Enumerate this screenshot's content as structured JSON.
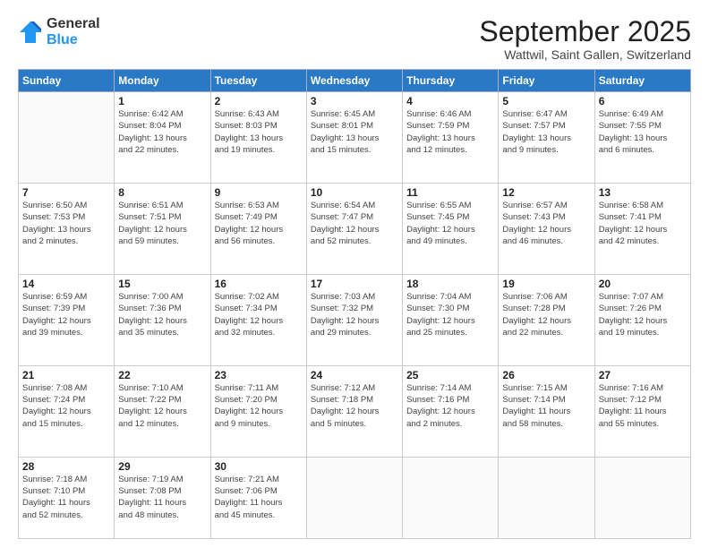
{
  "logo": {
    "general": "General",
    "blue": "Blue"
  },
  "title": {
    "month": "September 2025",
    "location": "Wattwil, Saint Gallen, Switzerland"
  },
  "weekdays": [
    "Sunday",
    "Monday",
    "Tuesday",
    "Wednesday",
    "Thursday",
    "Friday",
    "Saturday"
  ],
  "weeks": [
    [
      {
        "day": "",
        "info": ""
      },
      {
        "day": "1",
        "info": "Sunrise: 6:42 AM\nSunset: 8:04 PM\nDaylight: 13 hours\nand 22 minutes."
      },
      {
        "day": "2",
        "info": "Sunrise: 6:43 AM\nSunset: 8:03 PM\nDaylight: 13 hours\nand 19 minutes."
      },
      {
        "day": "3",
        "info": "Sunrise: 6:45 AM\nSunset: 8:01 PM\nDaylight: 13 hours\nand 15 minutes."
      },
      {
        "day": "4",
        "info": "Sunrise: 6:46 AM\nSunset: 7:59 PM\nDaylight: 13 hours\nand 12 minutes."
      },
      {
        "day": "5",
        "info": "Sunrise: 6:47 AM\nSunset: 7:57 PM\nDaylight: 13 hours\nand 9 minutes."
      },
      {
        "day": "6",
        "info": "Sunrise: 6:49 AM\nSunset: 7:55 PM\nDaylight: 13 hours\nand 6 minutes."
      }
    ],
    [
      {
        "day": "7",
        "info": "Sunrise: 6:50 AM\nSunset: 7:53 PM\nDaylight: 13 hours\nand 2 minutes."
      },
      {
        "day": "8",
        "info": "Sunrise: 6:51 AM\nSunset: 7:51 PM\nDaylight: 12 hours\nand 59 minutes."
      },
      {
        "day": "9",
        "info": "Sunrise: 6:53 AM\nSunset: 7:49 PM\nDaylight: 12 hours\nand 56 minutes."
      },
      {
        "day": "10",
        "info": "Sunrise: 6:54 AM\nSunset: 7:47 PM\nDaylight: 12 hours\nand 52 minutes."
      },
      {
        "day": "11",
        "info": "Sunrise: 6:55 AM\nSunset: 7:45 PM\nDaylight: 12 hours\nand 49 minutes."
      },
      {
        "day": "12",
        "info": "Sunrise: 6:57 AM\nSunset: 7:43 PM\nDaylight: 12 hours\nand 46 minutes."
      },
      {
        "day": "13",
        "info": "Sunrise: 6:58 AM\nSunset: 7:41 PM\nDaylight: 12 hours\nand 42 minutes."
      }
    ],
    [
      {
        "day": "14",
        "info": "Sunrise: 6:59 AM\nSunset: 7:39 PM\nDaylight: 12 hours\nand 39 minutes."
      },
      {
        "day": "15",
        "info": "Sunrise: 7:00 AM\nSunset: 7:36 PM\nDaylight: 12 hours\nand 35 minutes."
      },
      {
        "day": "16",
        "info": "Sunrise: 7:02 AM\nSunset: 7:34 PM\nDaylight: 12 hours\nand 32 minutes."
      },
      {
        "day": "17",
        "info": "Sunrise: 7:03 AM\nSunset: 7:32 PM\nDaylight: 12 hours\nand 29 minutes."
      },
      {
        "day": "18",
        "info": "Sunrise: 7:04 AM\nSunset: 7:30 PM\nDaylight: 12 hours\nand 25 minutes."
      },
      {
        "day": "19",
        "info": "Sunrise: 7:06 AM\nSunset: 7:28 PM\nDaylight: 12 hours\nand 22 minutes."
      },
      {
        "day": "20",
        "info": "Sunrise: 7:07 AM\nSunset: 7:26 PM\nDaylight: 12 hours\nand 19 minutes."
      }
    ],
    [
      {
        "day": "21",
        "info": "Sunrise: 7:08 AM\nSunset: 7:24 PM\nDaylight: 12 hours\nand 15 minutes."
      },
      {
        "day": "22",
        "info": "Sunrise: 7:10 AM\nSunset: 7:22 PM\nDaylight: 12 hours\nand 12 minutes."
      },
      {
        "day": "23",
        "info": "Sunrise: 7:11 AM\nSunset: 7:20 PM\nDaylight: 12 hours\nand 9 minutes."
      },
      {
        "day": "24",
        "info": "Sunrise: 7:12 AM\nSunset: 7:18 PM\nDaylight: 12 hours\nand 5 minutes."
      },
      {
        "day": "25",
        "info": "Sunrise: 7:14 AM\nSunset: 7:16 PM\nDaylight: 12 hours\nand 2 minutes."
      },
      {
        "day": "26",
        "info": "Sunrise: 7:15 AM\nSunset: 7:14 PM\nDaylight: 11 hours\nand 58 minutes."
      },
      {
        "day": "27",
        "info": "Sunrise: 7:16 AM\nSunset: 7:12 PM\nDaylight: 11 hours\nand 55 minutes."
      }
    ],
    [
      {
        "day": "28",
        "info": "Sunrise: 7:18 AM\nSunset: 7:10 PM\nDaylight: 11 hours\nand 52 minutes."
      },
      {
        "day": "29",
        "info": "Sunrise: 7:19 AM\nSunset: 7:08 PM\nDaylight: 11 hours\nand 48 minutes."
      },
      {
        "day": "30",
        "info": "Sunrise: 7:21 AM\nSunset: 7:06 PM\nDaylight: 11 hours\nand 45 minutes."
      },
      {
        "day": "",
        "info": ""
      },
      {
        "day": "",
        "info": ""
      },
      {
        "day": "",
        "info": ""
      },
      {
        "day": "",
        "info": ""
      }
    ]
  ]
}
